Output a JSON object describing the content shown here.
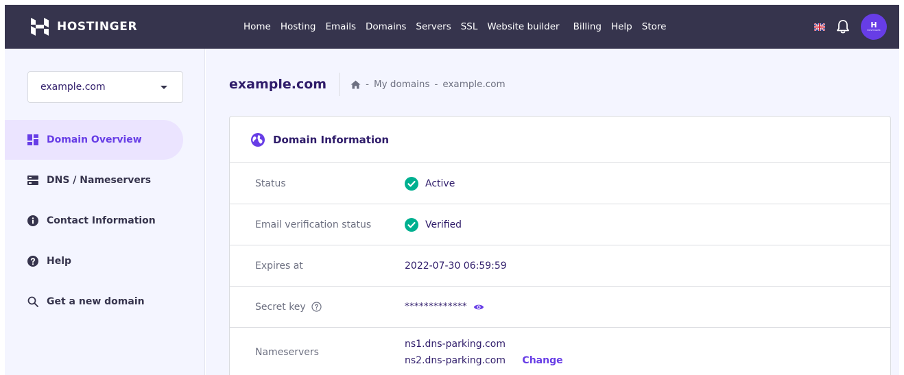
{
  "brand": {
    "name": "HOSTINGER",
    "accent": "#673de6",
    "topbar_bg": "#36344d"
  },
  "topnav": {
    "items": [
      "Home",
      "Hosting",
      "Emails",
      "Domains",
      "Servers",
      "SSL",
      "Website builder",
      "Billing",
      "Help",
      "Store"
    ]
  },
  "account": {
    "avatar_letter": "H",
    "avatar_text": "HOSTINGER"
  },
  "sidebar": {
    "domain_select": "example.com",
    "items": [
      {
        "label": "Domain Overview",
        "icon": "dashboard-icon",
        "active": true
      },
      {
        "label": "DNS / Nameservers",
        "icon": "server-icon",
        "active": false
      },
      {
        "label": "Contact Information",
        "icon": "info-icon",
        "active": false
      },
      {
        "label": "Help",
        "icon": "help-circle-icon",
        "active": false
      },
      {
        "label": "Get a new domain",
        "icon": "search-icon",
        "active": false
      }
    ]
  },
  "header": {
    "title": "example.com",
    "breadcrumb": {
      "sep": "-",
      "items": [
        "My domains",
        "example.com"
      ]
    }
  },
  "domain_info": {
    "title": "Domain Information",
    "status": {
      "label": "Status",
      "value": "Active"
    },
    "email_verification": {
      "label": "Email verification status",
      "value": "Verified"
    },
    "expires": {
      "label": "Expires at",
      "value": "2022-07-30 06:59:59"
    },
    "secret_key": {
      "label": "Secret key",
      "value": "*************"
    },
    "nameservers": {
      "label": "Nameservers",
      "values": [
        "ns1.dns-parking.com",
        "ns2.dns-parking.com"
      ],
      "change_label": "Change"
    }
  }
}
